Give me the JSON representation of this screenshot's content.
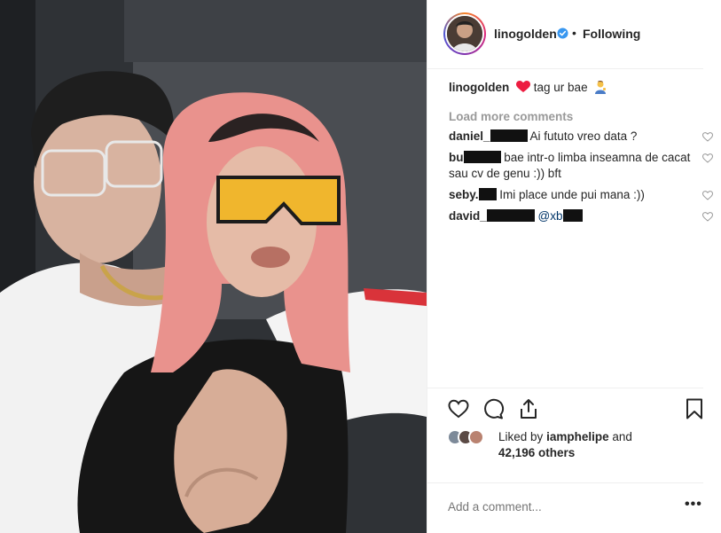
{
  "post": {
    "username": "linogolden",
    "separator": "•",
    "follow_status": "Following",
    "caption_username": "linogolden",
    "caption_text": "tag ur bae",
    "load_more": "Load more comments",
    "comments": [
      {
        "user_prefix": "daniel_",
        "text": "Ai fututo vreo data ?"
      },
      {
        "user_prefix": "bu",
        "text": "bae intr-o limba inseamna de cacat sau cv de genu :)) bft"
      },
      {
        "user_prefix": "seby.",
        "text": "Imi place unde pui mana :))"
      },
      {
        "user_prefix": "david_",
        "mention_prefix": "@xb"
      }
    ],
    "liked_by_prefix": "Liked by",
    "liked_by_user": "iamphelipe",
    "liked_by_and": "and",
    "others_count": "42,196 others",
    "add_comment_placeholder": "Add a comment...",
    "more_options": "•••"
  },
  "icons": [
    "heart-icon",
    "comment-icon",
    "share-icon",
    "bookmark-icon",
    "verified-badge-icon",
    "red-heart-emoji-icon",
    "person-emoji-icon"
  ],
  "colors": {
    "verified": "#3897f0",
    "red_heart": "#ed1c40",
    "mention": "#003569",
    "muted": "#999999",
    "border": "#efefef"
  }
}
